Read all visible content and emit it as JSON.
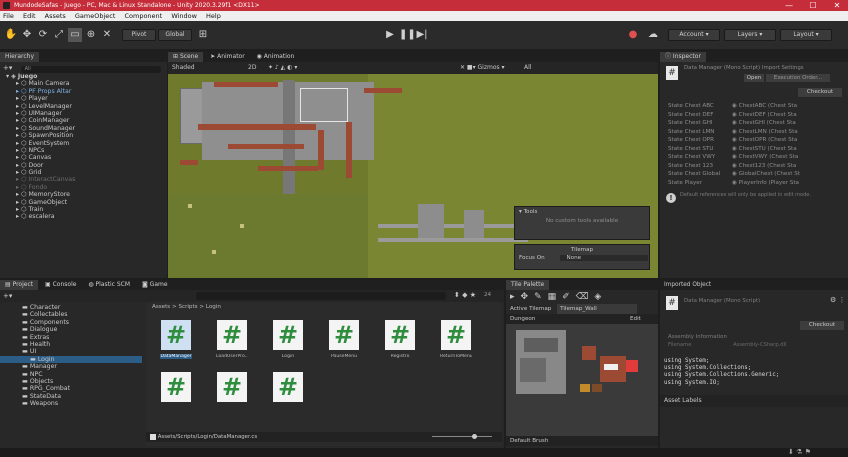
{
  "title_bar": {
    "text": "MundodeSafas - Juego - PC, Mac & Linux Standalone - Unity 2020.3.29f1 <DX11>",
    "minimize": "—",
    "maximize": "☐",
    "close": "✕"
  },
  "menu": [
    "File",
    "Edit",
    "Assets",
    "GameObject",
    "Component",
    "Window",
    "Help"
  ],
  "toolbar": {
    "pivot": "Pivot",
    "global": "Global",
    "account": "Account",
    "layers": "Layers",
    "layout": "Layout"
  },
  "hierarchy": {
    "tab": "Hierarchy",
    "search": "All",
    "items": [
      {
        "label": "Juego",
        "depth": 0,
        "scene": true
      },
      {
        "label": "Main Camera",
        "depth": 1
      },
      {
        "label": "PF Props Altar",
        "depth": 1,
        "prefab": true
      },
      {
        "label": "Player",
        "depth": 1
      },
      {
        "label": "LevelManager",
        "depth": 1
      },
      {
        "label": "UIManager",
        "depth": 1
      },
      {
        "label": "CoinManager",
        "depth": 1
      },
      {
        "label": "SoundManager",
        "depth": 1
      },
      {
        "label": "SpawnPosition",
        "depth": 1
      },
      {
        "label": "EventSystem",
        "depth": 1
      },
      {
        "label": "NPCs",
        "depth": 1
      },
      {
        "label": "Canvas",
        "depth": 1
      },
      {
        "label": "Door",
        "depth": 1
      },
      {
        "label": "Grid",
        "depth": 1
      },
      {
        "label": "InteractCanvas",
        "depth": 1,
        "disabled": true
      },
      {
        "label": "Fondo",
        "depth": 1,
        "disabled": true
      },
      {
        "label": "MemoryStore",
        "depth": 1
      },
      {
        "label": "GameObject",
        "depth": 1
      },
      {
        "label": "Train",
        "depth": 1
      },
      {
        "label": "escalera",
        "depth": 1
      }
    ]
  },
  "scene_view": {
    "tabs": [
      "Scene",
      "Animator",
      "Animation"
    ],
    "shading": "Shaded",
    "mode_2d": "2D",
    "gizmos": "Gizmos",
    "search": "All",
    "tools_overlay": {
      "title": "Tools",
      "text": "No custom tools available"
    },
    "tilemap_overlay": {
      "title": "Tilemap",
      "focus_label": "Focus On",
      "focus_value": "None"
    }
  },
  "inspector": {
    "tab": "Inspector",
    "component": "Data Manager (Mono Script) Import Settings",
    "open": "Open",
    "execution_order": "Execution Order...",
    "checkout": "Checkout",
    "fields": [
      {
        "name": "State Chest ABC",
        "value": "ChestABC (Chest Sta"
      },
      {
        "name": "State Chest DEF",
        "value": "ChestDEF (Chest Sta"
      },
      {
        "name": "State Chest GHI",
        "value": "ChestGHI (Chest Sta"
      },
      {
        "name": "State Chest LMN",
        "value": "ChestLMN (Chest Sta"
      },
      {
        "name": "State Chest OPR",
        "value": "ChestOPR (Chest Sta"
      },
      {
        "name": "State Chest STU",
        "value": "ChestSTU (Chest Sta"
      },
      {
        "name": "State Chest VWY",
        "value": "ChestVWY (Chest Sta"
      },
      {
        "name": "State Chest 123",
        "value": "Chest123 (Chest Sta"
      },
      {
        "name": "State Chest Global",
        "value": "GlobalChest (Chest St"
      },
      {
        "name": "State Player",
        "value": "PlayerInfo (Player Sta"
      }
    ],
    "info": "Default references will only be applied in edit mode.",
    "imported_title": "Imported Object",
    "imported_name": "Data Manager (Mono Script)",
    "checkout2": "Checkout",
    "assembly_title": "Assembly Information",
    "filename_label": "Filename",
    "filename_value": "Assembly-CSharp.dll",
    "code": [
      "using System;",
      "using System.Collections;",
      "using System.Collections.Generic;",
      "using System.IO;"
    ],
    "asset_labels": "Asset Labels"
  },
  "project": {
    "tabs": [
      "Project",
      "Console",
      "Plastic SCM",
      "Game"
    ],
    "count": "24",
    "folders": [
      {
        "label": "Character",
        "depth": 1
      },
      {
        "label": "Collectables",
        "depth": 1
      },
      {
        "label": "Components",
        "depth": 1
      },
      {
        "label": "Dialogue",
        "depth": 1
      },
      {
        "label": "Extras",
        "depth": 1
      },
      {
        "label": "Health",
        "depth": 1
      },
      {
        "label": "UI",
        "depth": 1
      },
      {
        "label": "Login",
        "depth": 2,
        "selected": true
      },
      {
        "label": "Manager",
        "depth": 1
      },
      {
        "label": "NPC",
        "depth": 1
      },
      {
        "label": "Objects",
        "depth": 1
      },
      {
        "label": "RPG_Combat",
        "depth": 1
      },
      {
        "label": "StateData",
        "depth": 1
      },
      {
        "label": "Weapons",
        "depth": 1
      }
    ],
    "breadcrumb": "Assets > Scripts > Login",
    "files": [
      "DataManager",
      "LoadUserPro...",
      "Login",
      "PauseMenu",
      "Registro",
      "ReturnToMenu",
      "",
      "",
      ""
    ],
    "status_path": "Assets/Scripts/Login/DataManager.cs"
  },
  "tile_palette": {
    "tab": "Tile Palette",
    "active_label": "Active Tilemap",
    "active_value": "Tilemap_Wall",
    "palette": "Dungeon",
    "edit": "Edit",
    "brush": "Default Brush"
  },
  "colors": {
    "grass": "#6f7a2c",
    "brick": "#9c4a33",
    "wall": "#8b8b8b",
    "selection": "#2c5d87",
    "title": "#c52d3a",
    "script_icon": "#2e8e3e"
  }
}
